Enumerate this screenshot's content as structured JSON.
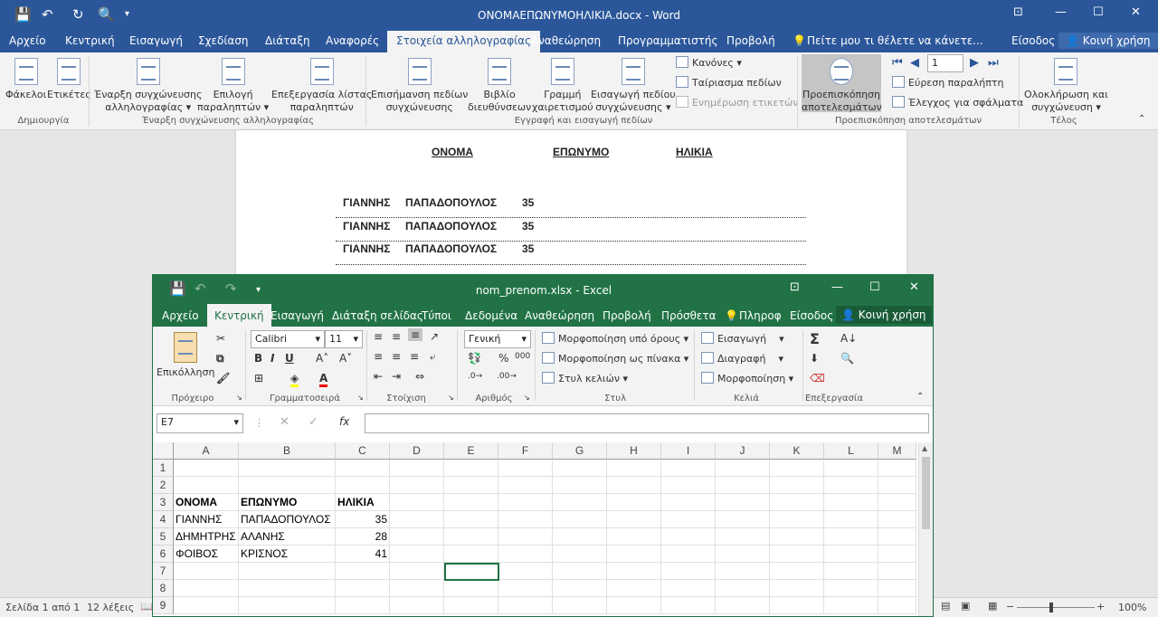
{
  "word": {
    "title": "ΟΝΟΜΑΕΠΩΝΥΜΟΗΛΙΚΙΑ.docx - Word",
    "tabs": [
      "Αρχείο",
      "Κεντρική",
      "Εισαγωγή",
      "Σχεδίαση",
      "Διάταξη",
      "Αναφορές",
      "Στοιχεία αλληλογραφίας",
      "Αναθεώρηση",
      "Προγραμματιστής",
      "Προβολή"
    ],
    "tell_me": "Πείτε μου τι θέλετε να κάνετε...",
    "signin": "Είσοδος",
    "share": "Κοινή χρήση",
    "ribbon": {
      "envelopes": "Φάκελοι",
      "labels": "Ετικέτες",
      "group_create": "Δημιουργία",
      "start_merge_l1": "Έναρξη συγχώνευσης",
      "start_merge_l2": "αλληλογραφίας ▾",
      "select_recipients_l1": "Επιλογή",
      "select_recipients_l2": "παραληπτών ▾",
      "edit_list_l1": "Επεξεργασία λίστας",
      "edit_list_l2": "παραληπτών",
      "group_start_merge": "Έναρξη συγχώνευσης αλληλογραφίας",
      "highlight_l1": "Επισήμανση πεδίων",
      "highlight_l2": "συγχώνευσης",
      "address_l1": "Βιβλίο",
      "address_l2": "διευθύνσεων",
      "greeting_l1": "Γραμμή",
      "greeting_l2": "χαιρετισμού",
      "insert_field_l1": "Εισαγωγή πεδίου",
      "insert_field_l2": "συγχώνευσης ▾",
      "rules": "Κανόνες ▾",
      "match_fields": "Ταίριασμα πεδίων",
      "update_labels": "Ενημέρωση ετικετών",
      "group_write": "Εγγραφή και εισαγωγή πεδίων",
      "preview_l1": "Προεπισκόπηση",
      "preview_l2": "αποτελεσμάτων",
      "record": "1",
      "find_recipient": "Εύρεση παραλήπτη",
      "check_errors": "Έλεγχος για σφάλματα",
      "group_preview": "Προεπισκόπηση αποτελεσμάτων",
      "finish_l1": "Ολοκλήρωση και",
      "finish_l2": "συγχώνευση ▾",
      "group_finish": "Τέλος"
    },
    "doc": {
      "headers": [
        "ΟΝΟΜΑ",
        "ΕΠΩΝΥΜΟ",
        "ΗΛΙΚΙΑ"
      ],
      "rows": [
        [
          "ΓΙΑΝΝΗΣ",
          "ΠΑΠΑΔΟΠΟΥΛΟΣ",
          "35"
        ],
        [
          "ΓΙΑΝΝΗΣ",
          "ΠΑΠΑΔΟΠΟΥΛΟΣ",
          "35"
        ],
        [
          "ΓΙΑΝΝΗΣ",
          "ΠΑΠΑΔΟΠΟΥΛΟΣ",
          "35"
        ]
      ]
    },
    "status": {
      "page": "Σελίδα 1 από 1",
      "words": "12 λέξεις",
      "zoom": "100%"
    }
  },
  "excel": {
    "title": "nom_prenom.xlsx - Excel",
    "tabs": [
      "Αρχείο",
      "Κεντρική",
      "Εισαγωγή",
      "Διάταξη σελίδας",
      "Τύποι",
      "Δεδομένα",
      "Αναθεώρηση",
      "Προβολή",
      "Πρόσθετα"
    ],
    "tell_me": "Πληροφ",
    "signin": "Είσοδος",
    "share": "Κοινή χρήση",
    "ribbon": {
      "paste": "Επικόλληση",
      "group_clipboard": "Πρόχειρο",
      "font_name": "Calibri",
      "font_size": "11",
      "group_font": "Γραμματοσειρά",
      "group_align": "Στοίχιση",
      "number_format": "Γενική",
      "group_number": "Αριθμός",
      "cond_format": "Μορφοποίηση υπό όρους ▾",
      "format_table": "Μορφοποίηση ως πίνακα ▾",
      "cell_styles": "Στυλ κελιών ▾",
      "group_styles": "Στυλ",
      "insert": "Εισαγωγή",
      "delete": "Διαγραφή",
      "format": "Μορφοποίηση",
      "group_cells": "Κελιά",
      "group_editing": "Επεξεργασία"
    },
    "name_box": "E7",
    "formula": "",
    "columns": [
      "A",
      "B",
      "C",
      "D",
      "E",
      "F",
      "G",
      "H",
      "I",
      "J",
      "K",
      "L",
      "M"
    ],
    "row_numbers": [
      "1",
      "2",
      "3",
      "4",
      "5",
      "6",
      "7",
      "8",
      "9"
    ],
    "cells": {
      "A3": "ΟΝΟΜΑ",
      "B3": "ΕΠΩΝΥΜΟ",
      "C3": "ΗΛΙΚΙΑ",
      "A4": "ΓΙΑΝΝΗΣ",
      "B4": "ΠΑΠΑΔΟΠΟΥΛΟΣ",
      "C4": "35",
      "A5": "ΔΗΜΗΤΡΗΣ",
      "B5": "ΑΛΑΝΗΣ",
      "C5": "28",
      "A6": "ΦΟΙΒΟΣ",
      "B6": "ΚΡΙΣΝΟΣ",
      "C6": "41"
    }
  }
}
